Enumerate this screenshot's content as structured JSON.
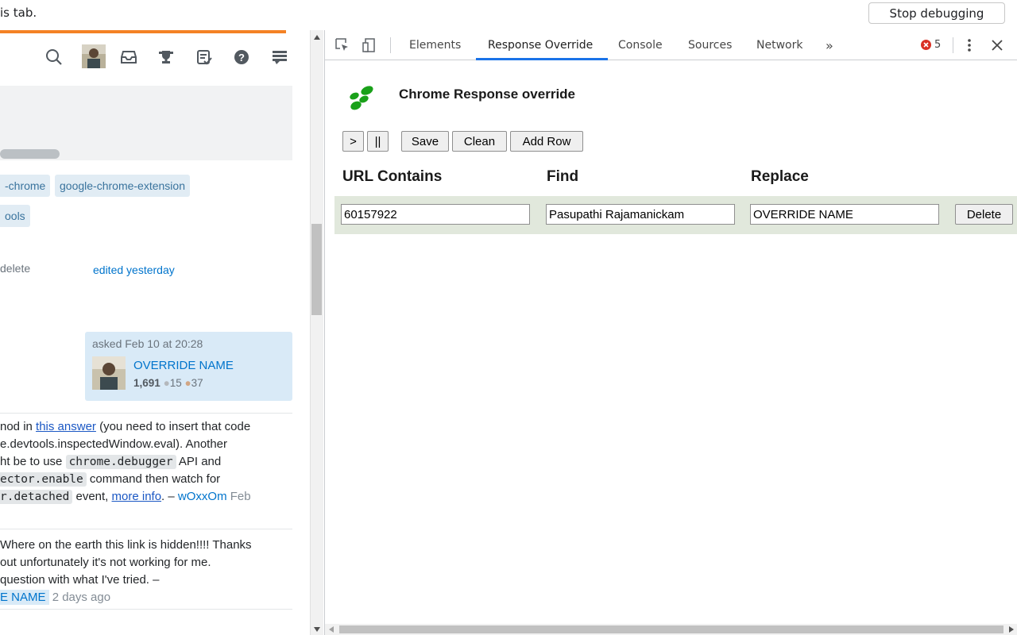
{
  "infobar": {
    "text": "is tab.",
    "stop_button": "Stop debugging"
  },
  "left_page": {
    "tags": [
      "-chrome",
      "google-chrome-extension",
      "ools"
    ],
    "delete_link": "delete",
    "edited_link": "edited yesterday",
    "asked": {
      "label": "asked Feb 10 at 20:28",
      "user": "OVERRIDE NAME",
      "reputation": "1,691",
      "silver": "15",
      "bronze": "37"
    },
    "comment1": {
      "line1_pre": "nod in ",
      "line1_link": "this answer",
      "line1_post": " (you need to insert that code",
      "line2": "e.devtools.inspectedWindow.eval). Another",
      "line3_pre": "ht be to use ",
      "line3_code": "chrome.debugger",
      "line3_post": " API and",
      "line4_code": "ector.enable",
      "line4_post": " command then watch for",
      "line5_code": "r.detached",
      "line5_mid": " event, ",
      "line5_link": "more info",
      "line5_post": ". – ",
      "line5_user": "wOxxOm",
      "line5_date": " Feb"
    },
    "comment2": {
      "line1": "Where on the earth this link is hidden!!!! Thanks",
      "line2": "out unfortunately it's not working for me.",
      "line3": " question with what I've tried. –",
      "line4_user": "E NAME",
      "line4_date": "2 days ago"
    }
  },
  "devtools": {
    "tabs": [
      "Elements",
      "Response Override",
      "Console",
      "Sources",
      "Network"
    ],
    "more_tabs": "»",
    "error_count": "5",
    "panel": {
      "title": "Chrome Response override",
      "buttons": {
        "play": ">",
        "pause": "||",
        "save": "Save",
        "clean": "Clean",
        "add_row": "Add Row"
      },
      "columns": [
        "URL Contains",
        "Find",
        "Replace"
      ],
      "rows": [
        {
          "url_contains": "60157922",
          "find": "Pasupathi Rajamanickam",
          "replace": "OVERRIDE NAME",
          "delete": "Delete"
        }
      ]
    }
  },
  "colors": {
    "so_orange": "#f48225",
    "tag_bg": "#e1ecf4",
    "devtools_active_tab": "#1a73e8",
    "row_bg": "#e1e8dc",
    "error_red": "#d93025",
    "logo_green": "#1aa11a"
  }
}
